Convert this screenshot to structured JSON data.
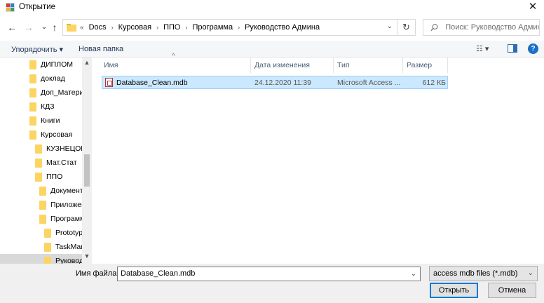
{
  "window": {
    "title": "Открытие",
    "close_glyph": "✕"
  },
  "nav": {
    "back": "←",
    "forward": "→",
    "history": "⌄",
    "up": "↑"
  },
  "address": {
    "prefix": "«",
    "crumbs": [
      "Docs",
      "Курсовая",
      "ППО",
      "Программа",
      "Руководство Админа"
    ],
    "separator": "›",
    "dropdown": "⌄",
    "refresh": "↻"
  },
  "search": {
    "placeholder": "Поиск: Руководство Админа"
  },
  "toolbar": {
    "organize": "Упорядочить ▾",
    "new_folder": "Новая папка",
    "view": "☷ ▾",
    "help": "?"
  },
  "navpane": {
    "items": [
      "ДИПЛОМ",
      "доклад",
      "Доп_Матери",
      "КДЗ",
      "Книги",
      "Курсовая",
      "КУЗНЕЦОВ",
      "Мат.Стат",
      "ППО",
      "Документ",
      "Приложен",
      "Программ",
      "Prototyp",
      "TaskMan",
      "Руковод"
    ],
    "scroll_up": "▲",
    "scroll_down": "▼"
  },
  "filelist": {
    "columns": {
      "name": "Имя",
      "date": "Дата изменения",
      "type": "Тип",
      "size": "Размер"
    },
    "sort_indicator": "^",
    "rows": [
      {
        "name": "Database_Clean.mdb",
        "date": "24.12.2020 11:39",
        "type": "Microsoft Access ...",
        "size": "612 КБ"
      }
    ]
  },
  "bottom": {
    "filename_label": "Имя файла:",
    "filename_value": "Database_Clean.mdb",
    "filter_value": "access mdb files (*.mdb)",
    "open_button": "Открыть",
    "cancel_button": "Отмена"
  },
  "colors": {
    "accent": "#0078d7",
    "selection": "#cce8ff",
    "folder": "#fcd462"
  }
}
